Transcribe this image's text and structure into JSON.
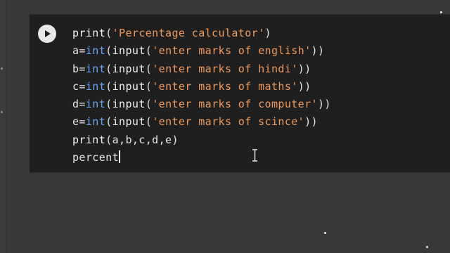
{
  "cell": {
    "run_button_icon": "play-icon",
    "lines": [
      [
        {
          "t": "print",
          "c": "fn"
        },
        {
          "t": "(",
          "c": "punc"
        },
        {
          "t": "'Percentage calculator'",
          "c": "str"
        },
        {
          "t": ")",
          "c": "punc"
        }
      ],
      [
        {
          "t": "a=",
          "c": "punc"
        },
        {
          "t": "int",
          "c": "kw"
        },
        {
          "t": "(",
          "c": "punc"
        },
        {
          "t": "input",
          "c": "fn"
        },
        {
          "t": "(",
          "c": "punc"
        },
        {
          "t": "'enter marks of english'",
          "c": "str"
        },
        {
          "t": "))",
          "c": "punc"
        }
      ],
      [
        {
          "t": "b=",
          "c": "punc"
        },
        {
          "t": "int",
          "c": "kw"
        },
        {
          "t": "(",
          "c": "punc"
        },
        {
          "t": "input",
          "c": "fn"
        },
        {
          "t": "(",
          "c": "punc"
        },
        {
          "t": "'enter marks of hindi'",
          "c": "str"
        },
        {
          "t": "))",
          "c": "punc"
        }
      ],
      [
        {
          "t": "c=",
          "c": "punc"
        },
        {
          "t": "int",
          "c": "kw"
        },
        {
          "t": "(",
          "c": "punc"
        },
        {
          "t": "input",
          "c": "fn"
        },
        {
          "t": "(",
          "c": "punc"
        },
        {
          "t": "'enter marks of maths'",
          "c": "str"
        },
        {
          "t": "))",
          "c": "punc"
        }
      ],
      [
        {
          "t": "d=",
          "c": "punc"
        },
        {
          "t": "int",
          "c": "kw"
        },
        {
          "t": "(",
          "c": "punc"
        },
        {
          "t": "input",
          "c": "fn"
        },
        {
          "t": "(",
          "c": "punc"
        },
        {
          "t": "'enter marks of computer'",
          "c": "str"
        },
        {
          "t": "))",
          "c": "punc"
        }
      ],
      [
        {
          "t": "e=",
          "c": "punc"
        },
        {
          "t": "int",
          "c": "kw"
        },
        {
          "t": "(",
          "c": "punc"
        },
        {
          "t": "input",
          "c": "fn"
        },
        {
          "t": "(",
          "c": "punc"
        },
        {
          "t": "'enter marks of scince'",
          "c": "str"
        },
        {
          "t": "))",
          "c": "punc"
        }
      ],
      [
        {
          "t": "print",
          "c": "fn"
        },
        {
          "t": "(a,b,c,d,e)",
          "c": "punc"
        }
      ],
      [
        {
          "t": "percent",
          "c": "punc"
        }
      ]
    ]
  },
  "colors": {
    "page_background": "#383838",
    "cell_background": "#1f1f1f",
    "keyword": "#6aa6f0",
    "string": "#ee9a5c",
    "text": "#e6e6e6"
  }
}
